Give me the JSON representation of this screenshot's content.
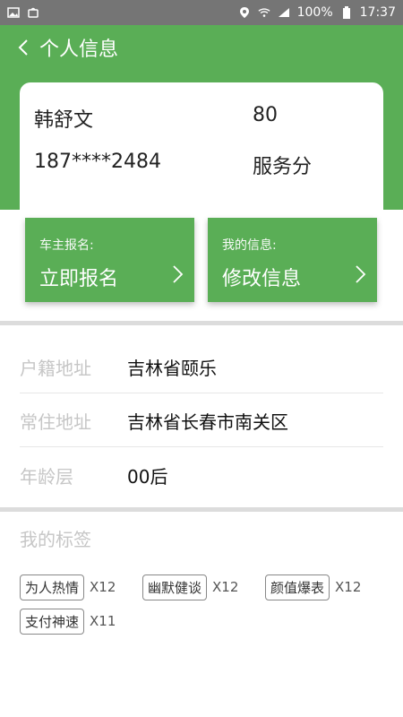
{
  "status_bar": {
    "battery": "100%",
    "time": "17:37",
    "icons": [
      "image-icon",
      "bag-icon",
      "location-icon",
      "wifi-icon",
      "signal-icon",
      "battery-icon"
    ]
  },
  "nav": {
    "title": "个人信息",
    "back_icon": "chevron-left-icon"
  },
  "profile": {
    "name": "韩舒文",
    "phone": "187****2484",
    "score": "80",
    "score_label": "服务分"
  },
  "actions": [
    {
      "subtitle": "车主报名:",
      "title": "立即报名",
      "icon": "chevron-right-icon"
    },
    {
      "subtitle": "我的信息:",
      "title": "修改信息",
      "icon": "chevron-right-icon"
    }
  ],
  "info": [
    {
      "label": "户籍地址",
      "value": "吉林省颐乐"
    },
    {
      "label": "常住地址",
      "value": "吉林省长春市南关区"
    },
    {
      "label": "年龄层",
      "value": "00后"
    }
  ],
  "tags": {
    "title": "我的标签",
    "items": [
      {
        "label": "为人热情",
        "count": "X12"
      },
      {
        "label": "幽默健谈",
        "count": "X12"
      },
      {
        "label": "颜值爆表",
        "count": "X12"
      },
      {
        "label": "支付神速",
        "count": "X11"
      }
    ]
  },
  "colors": {
    "primary": "#5aae56",
    "status_bar": "#757575",
    "label": "#c6c6c6"
  }
}
